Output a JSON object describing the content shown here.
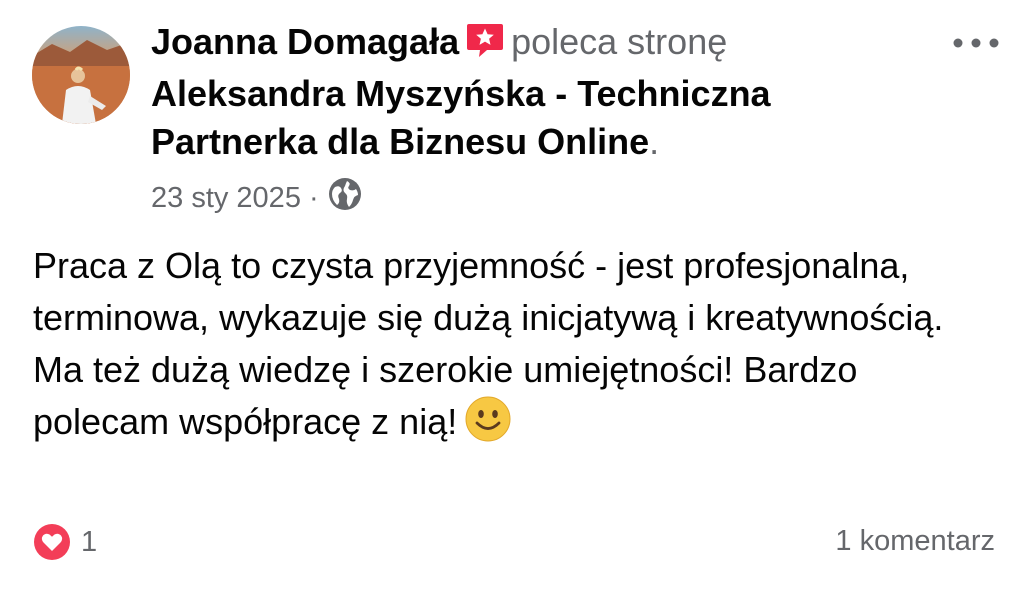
{
  "post": {
    "author": {
      "name": "Joanna Domagała",
      "avatar_icon": "avatar-photo-icon"
    },
    "recommendation_icon": "recommendation-star-icon",
    "verb": "poleca stronę",
    "page_name": "Aleksandra Myszyńska - Techniczna Partnerka dla Biznesu Online",
    "period": ".",
    "date": "23 sty 2025",
    "separator": "·",
    "privacy_icon": "globe-icon",
    "more_icon": "more-options-icon",
    "body_text": "Praca z Olą to czysta przyjemność - jest profesjonalna, terminowa, wykazuje się dużą inicjatywą i kreatywnością. Ma też dużą wiedzę i szerokie umiejętności! Bardzo polecam współpracę z nią!",
    "emoji_icon": "smiling-face-emoji-icon",
    "reactions": {
      "icon": "love-reaction-icon",
      "count": "1"
    },
    "comments_label": "1 komentarz"
  },
  "colors": {
    "text_primary": "#050505",
    "text_secondary": "#65676b",
    "recommend_red": "#f0284a",
    "love_red": "#f33e58",
    "emoji_yellow": "#f7c843"
  }
}
